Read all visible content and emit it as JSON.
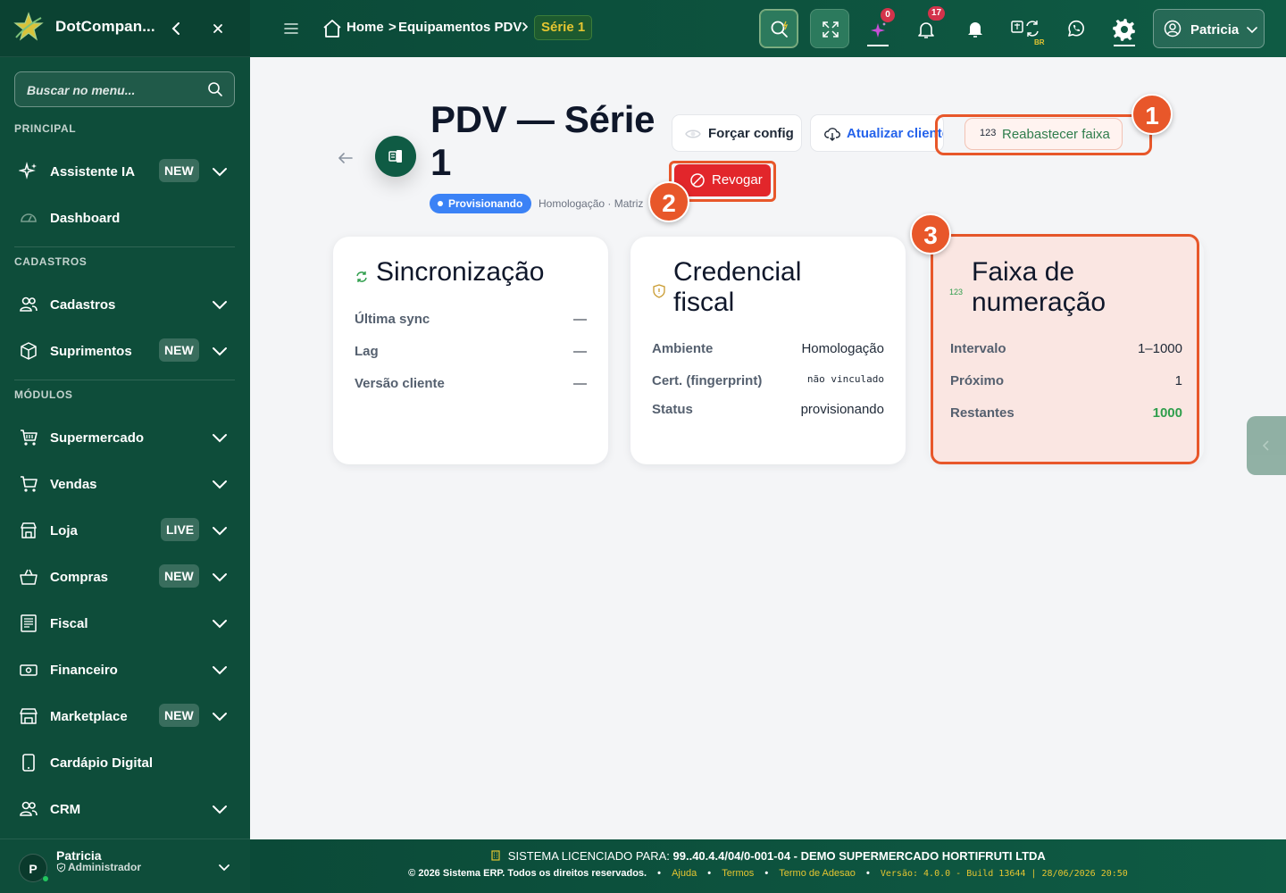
{
  "app": {
    "name": "DotCompan..."
  },
  "sidebar": {
    "search_placeholder": "Buscar no menu...",
    "sections": {
      "principal": "PRINCIPAL",
      "cadastros": "CADASTROS",
      "modulos": "MÓDULOS"
    },
    "items": [
      {
        "label": "Assistente IA",
        "icon": "sparkles-icon",
        "badge": "NEW",
        "has_chevron": true
      },
      {
        "label": "Dashboard",
        "icon": "gauge-icon",
        "badge": "",
        "has_chevron": false
      },
      {
        "label": "Cadastros",
        "icon": "users-icon",
        "badge": "",
        "has_chevron": true
      },
      {
        "label": "Suprimentos",
        "icon": "box-icon",
        "badge": "NEW",
        "has_chevron": true
      },
      {
        "label": "Supermercado",
        "icon": "cart-icon",
        "badge": "",
        "has_chevron": true
      },
      {
        "label": "Vendas",
        "icon": "shopping-cart-icon",
        "badge": "",
        "has_chevron": true
      },
      {
        "label": "Loja",
        "icon": "store-icon",
        "badge": "LIVE",
        "has_chevron": true
      },
      {
        "label": "Compras",
        "icon": "basket-icon",
        "badge": "NEW",
        "has_chevron": true
      },
      {
        "label": "Fiscal",
        "icon": "receipt-icon",
        "badge": "",
        "has_chevron": true
      },
      {
        "label": "Financeiro",
        "icon": "cash-icon",
        "badge": "",
        "has_chevron": true
      },
      {
        "label": "Marketplace",
        "icon": "marketplace-icon",
        "badge": "NEW",
        "has_chevron": true
      },
      {
        "label": "Cardápio Digital",
        "icon": "phone-icon",
        "badge": "",
        "has_chevron": false
      },
      {
        "label": "CRM",
        "icon": "users-icon",
        "badge": "",
        "has_chevron": true
      }
    ],
    "user": {
      "initial": "P",
      "name": "Patricia",
      "role": "Administrador"
    }
  },
  "topbar": {
    "breadcrumb": {
      "home": "Home",
      "sep": ">",
      "section": "Equipamentos PDV",
      "current": "Série 1"
    },
    "badges": {
      "ai": "0",
      "notifications": "17"
    },
    "lang": "BR",
    "user_name": "Patricia"
  },
  "page": {
    "title": "PDV — Série 1",
    "status": "Provisionando",
    "meta": "Homologação · Matriz",
    "actions": {
      "force_config": "Forçar config",
      "update_client": "Atualizar cliente",
      "refill_range": "Reabastecer faixa",
      "refill_icon_text": "123",
      "revoke": "Revogar"
    },
    "markers": [
      "1",
      "2",
      "3"
    ],
    "cards": {
      "sync": {
        "title": "Sincronização",
        "rows": [
          {
            "label": "Última sync",
            "value": "—"
          },
          {
            "label": "Lag",
            "value": "—"
          },
          {
            "label": "Versão cliente",
            "value": "—"
          }
        ]
      },
      "credential": {
        "title": "Credencial fiscal",
        "rows": [
          {
            "label": "Ambiente",
            "value": "Homologação"
          },
          {
            "label": "Cert. (fingerprint)",
            "value": "não vinculado"
          },
          {
            "label": "Status",
            "value": "provisionando"
          }
        ]
      },
      "range": {
        "title": "Faixa de numeração",
        "icon_text": "123",
        "rows": [
          {
            "label": "Intervalo",
            "value": "1–1000"
          },
          {
            "label": "Próximo",
            "value": "1"
          },
          {
            "label": "Restantes",
            "value": "1000"
          }
        ]
      }
    }
  },
  "footer": {
    "license_label": "SISTEMA LICENCIADO PARA:",
    "license_value": "99..40.4.4/04/0-001-04 - DEMO SUPERMERCADO HORTIFRUTI LTDA",
    "copyright": "© 2026 Sistema ERP. Todos os direitos reservados.",
    "links": [
      "Ajuda",
      "Termos",
      "Termo de Adesao"
    ],
    "version": "Versão: 4.0.0 - Build 13644 | 28/06/2026 20:50"
  },
  "colors": {
    "primary": "#0e4d3a",
    "accent": "#e5c531",
    "danger": "#e2262b",
    "highlight": "#e8572a",
    "status_blue": "#3b82f6",
    "success": "#2f9e4c"
  }
}
